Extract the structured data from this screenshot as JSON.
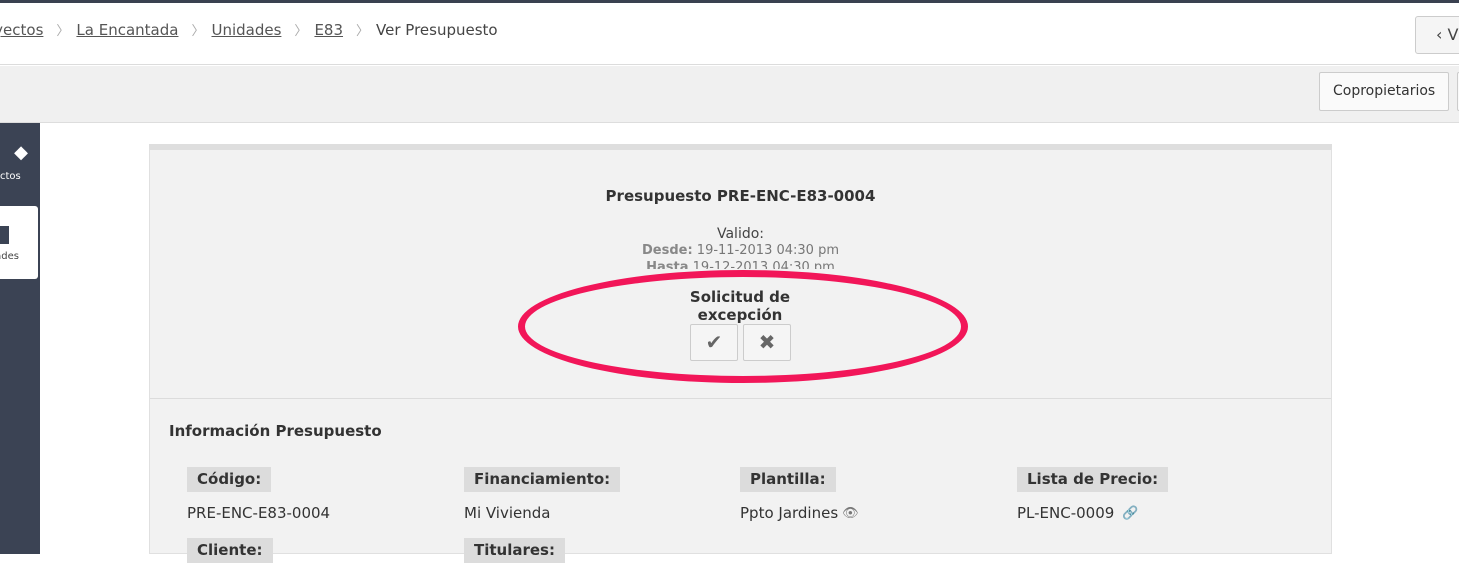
{
  "breadcrumb": {
    "items": [
      "oyectos",
      "La Encantada",
      "Unidades",
      "E83"
    ],
    "current": "Ver Presupuesto"
  },
  "header": {
    "back_label": "‹ V"
  },
  "toolbar": {
    "copropietarios_label": "Copropietarios"
  },
  "sidebar": {
    "items": [
      {
        "label": "ctos",
        "icon": "cube-icon"
      },
      {
        "label": "ades",
        "icon": "building-icon"
      }
    ]
  },
  "budget": {
    "title": "Presupuesto PRE-ENC-E83-0004",
    "valid_label": "Valido:",
    "desde_label": "Desde:",
    "desde_value": "19-11-2013 04:30 pm",
    "hasta_label": "Hasta",
    "hasta_value": "19-12-2013 04:30 pm",
    "solicitud_line1": "Solicitud de",
    "solicitud_line2": "excepción",
    "approve_icon": "✔",
    "reject_icon": "✖"
  },
  "info": {
    "section_title": "Información Presupuesto",
    "fields": [
      {
        "label": "Código:",
        "value": "PRE-ENC-E83-0004"
      },
      {
        "label": "Financiamiento:",
        "value": "Mi Vivienda"
      },
      {
        "label": "Plantilla:",
        "value": "Ppto Jardines"
      },
      {
        "label": "Lista de Precio:",
        "value": "PL-ENC-0009"
      },
      {
        "label": "Cliente:"
      },
      {
        "label": "Titulares:"
      }
    ]
  },
  "colors": {
    "highlight": "#f21659",
    "sidebar": "#3b4354"
  }
}
